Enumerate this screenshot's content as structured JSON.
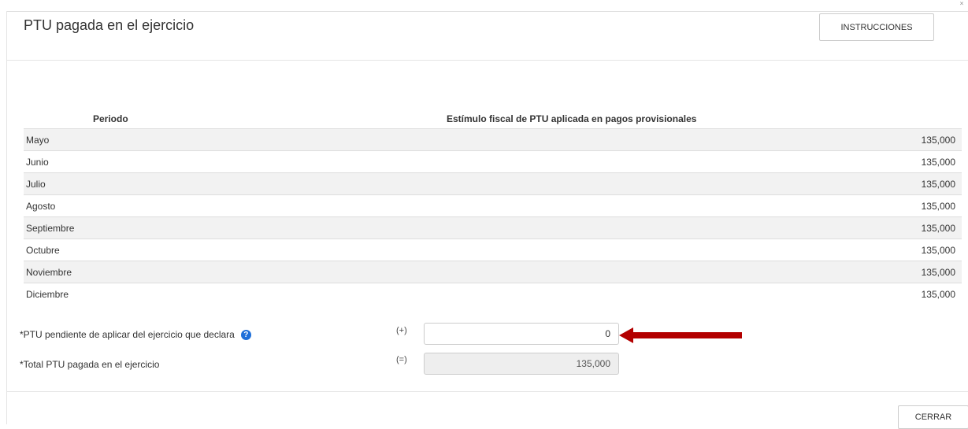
{
  "header": {
    "title": "PTU pagada en el ejercicio",
    "instructions_label": "INSTRUCCIONES"
  },
  "table": {
    "columns": [
      "Periodo",
      "Estímulo fiscal de PTU aplicada en pagos provisionales"
    ],
    "rows": [
      {
        "period": "Mayo",
        "value": "135,000"
      },
      {
        "period": "Junio",
        "value": "135,000"
      },
      {
        "period": "Julio",
        "value": "135,000"
      },
      {
        "period": "Agosto",
        "value": "135,000"
      },
      {
        "period": "Septiembre",
        "value": "135,000"
      },
      {
        "period": "Octubre",
        "value": "135,000"
      },
      {
        "period": "Noviembre",
        "value": "135,000"
      },
      {
        "period": "Diciembre",
        "value": "135,000"
      }
    ]
  },
  "form": {
    "ptu_pending_label": "*PTU pendiente de aplicar del ejercicio que declara",
    "ptu_pending_sign": "(+)",
    "ptu_pending_value": "0",
    "total_label": "*Total PTU pagada en el ejercicio",
    "total_sign": "(=)",
    "total_value": "135,000"
  },
  "footer": {
    "close_label": "CERRAR"
  },
  "colors": {
    "arrow": "#b30000",
    "help_icon": "#1e6fd9",
    "row_stripe": "#f2f2f2"
  },
  "icons": {
    "help": "question-circle-icon",
    "arrow": "red-arrow-left-icon"
  }
}
